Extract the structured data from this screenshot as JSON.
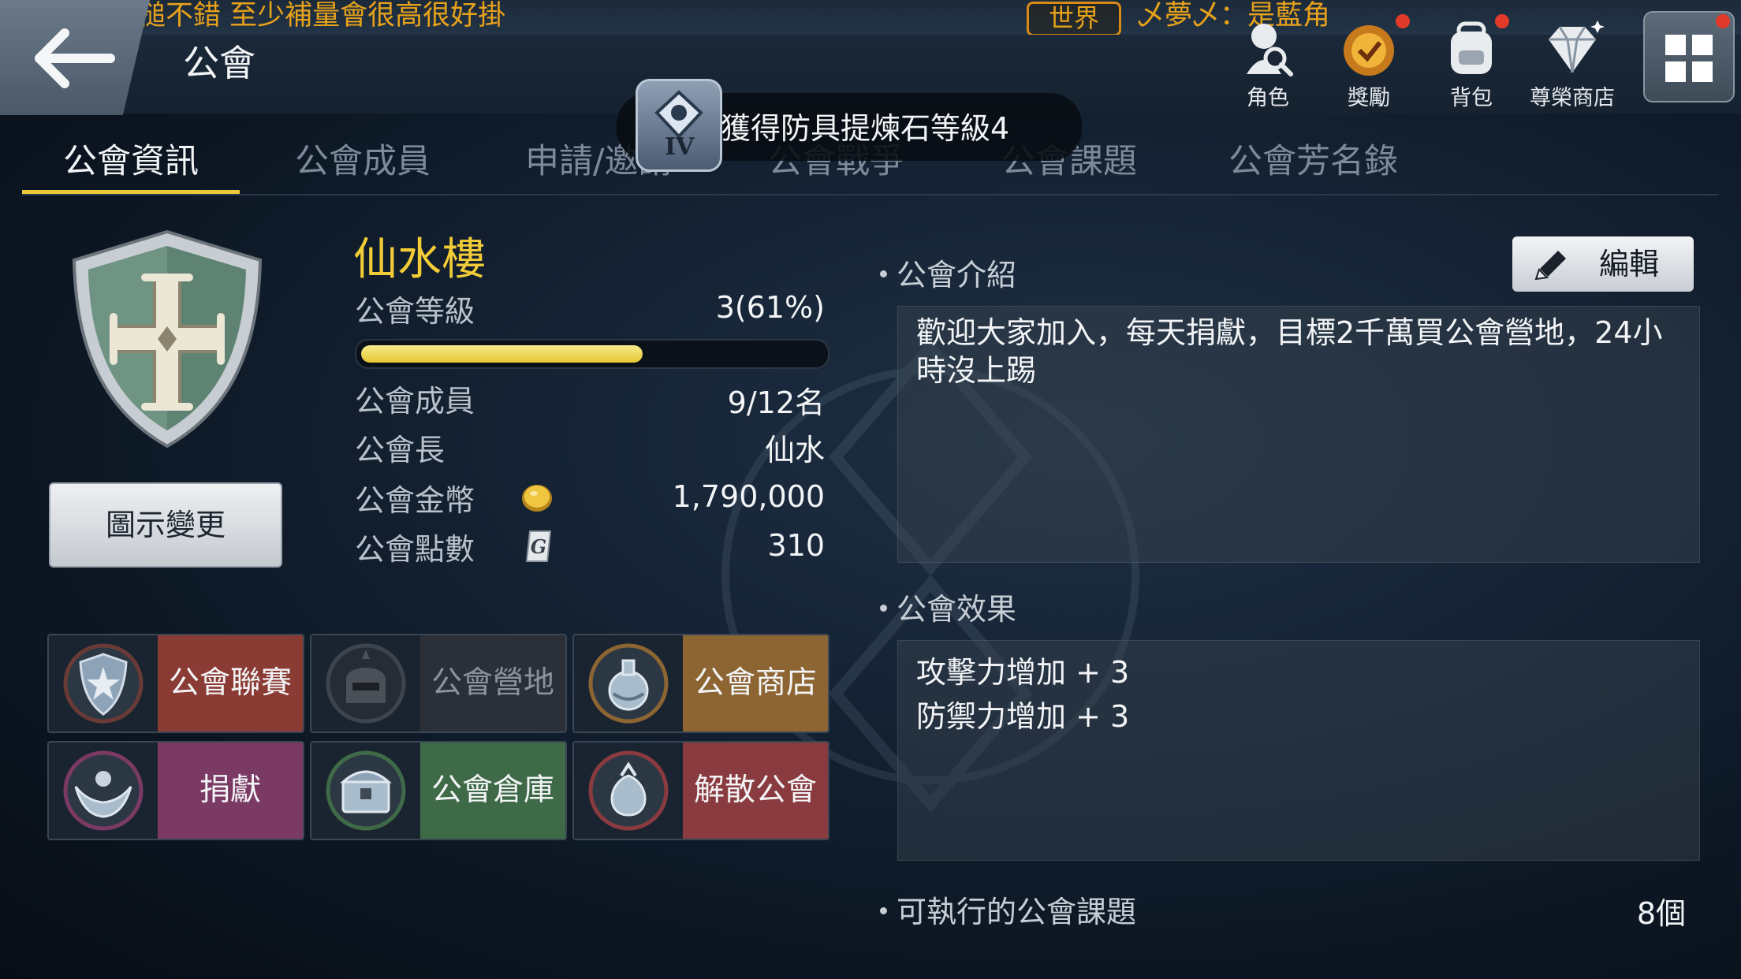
{
  "ticker": {
    "left_text": "比：有單手槌不錯 至少補量會很高很好掛",
    "channel": "世界",
    "right_text": "乄夢乄：是藍角"
  },
  "header": {
    "title": "公會",
    "icons": [
      {
        "label": "角色",
        "icon": "character-search-icon"
      },
      {
        "label": "獎勵",
        "icon": "reward-icon"
      },
      {
        "label": "背包",
        "icon": "backpack-icon"
      },
      {
        "label": "尊榮商店",
        "icon": "diamond-shop-icon"
      }
    ]
  },
  "toast": {
    "text": "獲得防具提煉石等級4",
    "badge": "IV"
  },
  "tabs": [
    "公會資訊",
    "公會成員",
    "申請/邀請",
    "公會戰爭",
    "公會課題",
    "公會芳名錄"
  ],
  "guild": {
    "name": "仙水樓",
    "level_label": "公會等級",
    "level_value": "3(61%)",
    "level_progress": 0.61,
    "members_label": "公會成員",
    "members_value": "9/12名",
    "leader_label": "公會長",
    "leader_value": "仙水",
    "gold_label": "公會金幣",
    "gold_value": "1,790,000",
    "points_label": "公會點數",
    "points_value": "310",
    "change_icon_button": "圖示變更"
  },
  "functions": [
    {
      "label": "公會聯賽",
      "color": "#8a3b33",
      "icon": "league-shield-icon"
    },
    {
      "label": "公會營地",
      "color": "#2b3038",
      "icon": "camp-helmet-icon"
    },
    {
      "label": "公會商店",
      "color": "#8c6532",
      "icon": "shop-potion-icon"
    },
    {
      "label": "捐獻",
      "color": "#7b3a64",
      "icon": "donate-hands-icon"
    },
    {
      "label": "公會倉庫",
      "color": "#3f6a48",
      "icon": "storage-chest-icon"
    },
    {
      "label": "解散公會",
      "color": "#8a3b3f",
      "icon": "disband-bag-icon"
    }
  ],
  "intro": {
    "heading": "公會介紹",
    "edit_button": "編輯",
    "text": "歡迎大家加入，每天捐獻，目標2千萬買公會營地，24小時沒上踢"
  },
  "effects": {
    "heading": "公會效果",
    "lines": [
      "攻擊力增加 + 3",
      "防禦力增加 + 3"
    ]
  },
  "quests": {
    "heading": "可執行的公會課題",
    "count": "8個"
  }
}
